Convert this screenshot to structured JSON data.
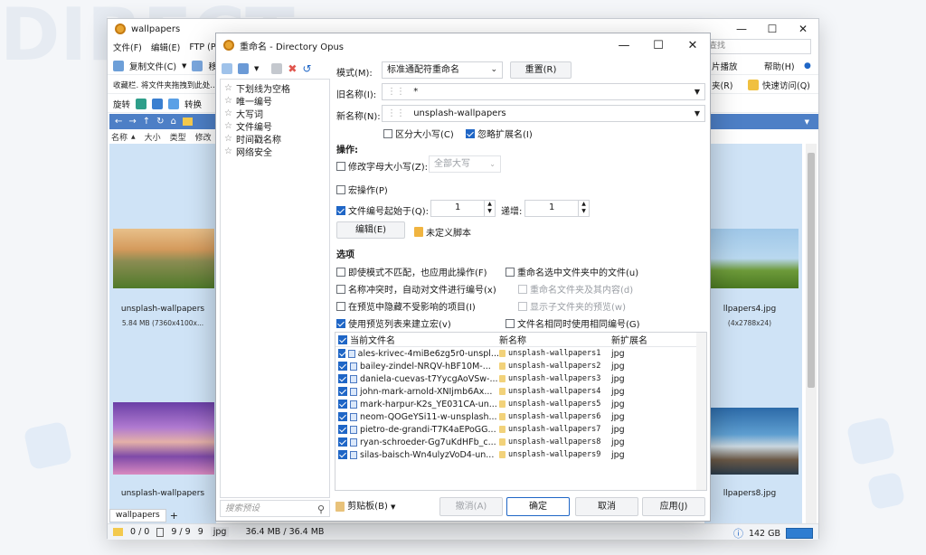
{
  "main_window": {
    "title": "wallpapers",
    "menu": [
      "文件(F)",
      "编辑(E)",
      "FTP (P)"
    ],
    "search_placeholder": "查找",
    "toolbar1": {
      "copy_label": "复制文件(C)",
      "move_label": "移动",
      "play_label": "片播放",
      "help_label": "帮助(H)"
    },
    "toolbar2": {
      "favorites_label": "收藏栏. 将文件夹拖拽到此处...",
      "quick_access_label": "快速访问(Q)",
      "folder_label": "夹(R)"
    },
    "toolbar3": {
      "rotate_label": "旋转",
      "convert_label": "转换"
    },
    "columns": [
      "名称",
      "大小",
      "类型",
      "修改"
    ],
    "thumbs": [
      {
        "caption": "unsplash-wallpapers",
        "sub": "5.84 MB (7360x4100x..."
      },
      {
        "caption": "unsplash-wallpapers",
        "sub": ""
      },
      {
        "caption": "llpapers4.jpg",
        "sub": "(4x2788x24)"
      },
      {
        "caption": "llpapers8.jpg",
        "sub": ""
      }
    ],
    "tab_label": "wallpapers",
    "tab_add": "+",
    "status": {
      "sel_files": "0 / 0",
      "total_files": "9 / 9",
      "count": "9",
      "ext": "jpg",
      "size": "36.4 MB / 36.4 MB",
      "disk": "142 GB"
    }
  },
  "dialog": {
    "title": "重命名 - Directory Opus",
    "presets": [
      "下划线为空格",
      "唯一编号",
      "大写词",
      "文件编号",
      "时间戳名称",
      "网络安全"
    ],
    "preset_search_placeholder": "搜索预设",
    "mode_label": "模式(M):",
    "mode_value": "标准通配符重命名",
    "reset_label": "重置(R)",
    "old_name_label": "旧名称(I):",
    "old_name_value": "*",
    "new_name_label": "新名称(N):",
    "new_name_value": "unsplash-wallpapers",
    "case_sensitive_label": "区分大小写(C)",
    "ignore_ext_label": "忽略扩展名(I)",
    "ops_title": "操作:",
    "change_case_label": "修改字母大小写(Z):",
    "change_case_value": "全部大写",
    "macro_label": "宏操作(P)",
    "number_from_label": "文件编号起始于(Q):",
    "number_from_value": "1",
    "increment_label": "递增:",
    "increment_value": "1",
    "edit_label": "编辑(E)",
    "script_label": "未定义脚本",
    "options_title": "选项",
    "opt1": "即使模式不匹配，也应用此操作(F)",
    "opt2": "名称冲突时，自动对文件进行编号(x)",
    "opt3": "在预览中隐藏不受影响的项目(I)",
    "opt4": "使用预览列表来建立宏(v)",
    "opt5": "重命名选中文件夹中的文件(u)",
    "opt6": "重命名文件夹及其内容(d)",
    "opt7": "显示子文件夹的预览(w)",
    "opt8": "文件名相同时使用相同编号(G)",
    "preview_headers": {
      "current": "当前文件名",
      "new": "新名称",
      "ext": "新扩展名"
    },
    "preview_rows": [
      {
        "current": "ales-krivec-4miBe6zg5r0-unspl...",
        "new": "unsplash-wallpapers1",
        "ext": "jpg"
      },
      {
        "current": "bailey-zindel-NRQV-hBF10M-...",
        "new": "unsplash-wallpapers2",
        "ext": "jpg"
      },
      {
        "current": "daniela-cuevas-t7YycgAoVSw-...",
        "new": "unsplash-wallpapers3",
        "ext": "jpg"
      },
      {
        "current": "john-mark-arnold-XNIjmb6Ax...",
        "new": "unsplash-wallpapers4",
        "ext": "jpg"
      },
      {
        "current": "mark-harpur-K2s_YE031CA-un...",
        "new": "unsplash-wallpapers5",
        "ext": "jpg"
      },
      {
        "current": "neom-QOGeYSi11-w-unsplash...",
        "new": "unsplash-wallpapers6",
        "ext": "jpg"
      },
      {
        "current": "pietro-de-grandi-T7K4aEPoGG...",
        "new": "unsplash-wallpapers7",
        "ext": "jpg"
      },
      {
        "current": "ryan-schroeder-Gg7uKdHFb_c...",
        "new": "unsplash-wallpapers8",
        "ext": "jpg"
      },
      {
        "current": "silas-baisch-Wn4ulyzVoD4-un...",
        "new": "unsplash-wallpapers9",
        "ext": "jpg"
      }
    ],
    "clipboard_label": "剪贴板(B)",
    "undo_label": "撤消(A)",
    "ok_label": "确定",
    "cancel_label": "取消",
    "apply_label": "应用(J)"
  }
}
